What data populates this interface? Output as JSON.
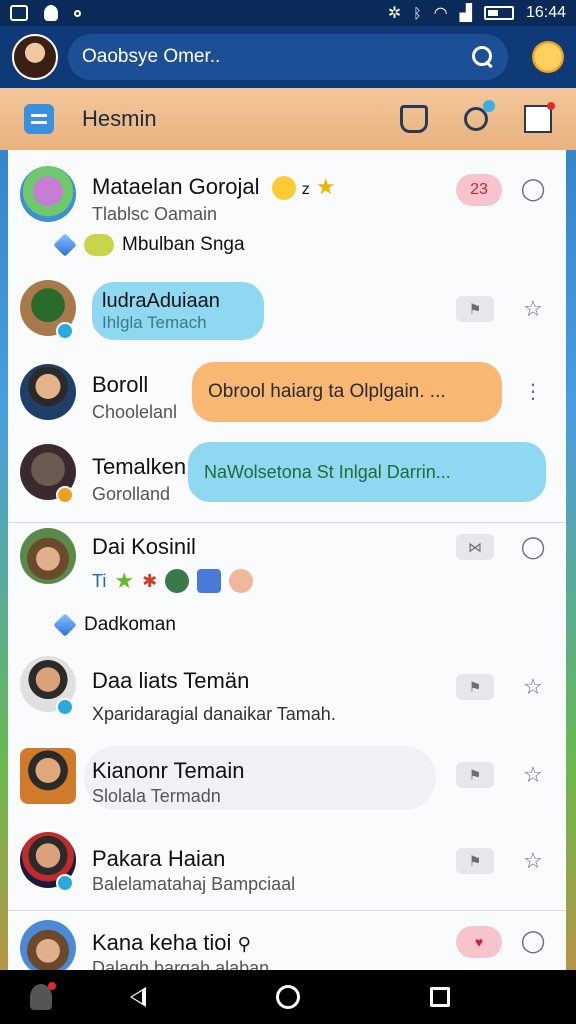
{
  "status_bar": {
    "time": "16:44"
  },
  "app_bar": {
    "search_placeholder": "Oaobsye Omer.."
  },
  "tab_header": {
    "title": "Hesmin"
  },
  "chats": [
    {
      "name": "Mataelan Gorojal",
      "name_extra": "z",
      "sub": "Tlablsc Oamain",
      "badge_count": "23",
      "sub_item": "Mbulban Snga"
    },
    {
      "name": "ludraAduiaan",
      "sub": "Ihlgla Temach"
    },
    {
      "name": "Boroll",
      "sub": "Choolelanl",
      "bubble": "Obrool haiarg ta Olplgain. ..."
    },
    {
      "name": "Temalken",
      "sub": "Gorolland",
      "bubble": "NaWolsetona  St Inlgal Darrin..."
    },
    {
      "name": "Dai Kosinil",
      "sub_prefix": "Ti",
      "sub_item": "Dadkoman"
    },
    {
      "name": "Daa liats Temän",
      "sub": "Xparidaragial danaikar Tamah."
    },
    {
      "name": "Kianonr Temain",
      "sub": "Slolala Termadn"
    },
    {
      "name": "Pakara Haian",
      "sub": "Balelamatahaj Bampciaal"
    },
    {
      "name": "Kana keha tioi",
      "sub": "Dalagh bargah alaban"
    }
  ],
  "colors": {
    "bubble_orange": "#f9b774",
    "bubble_blue": "#8fd8f2",
    "badge_pink": "#f7c4cd"
  }
}
